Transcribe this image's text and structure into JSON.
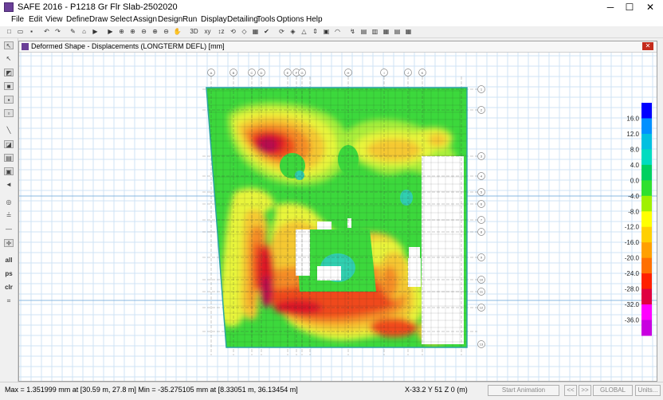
{
  "window": {
    "title": "SAFE 2016 - P1218 Gr Flr Slab-2502020",
    "minimize": "─",
    "maximize": "☐",
    "close": "✕"
  },
  "menu": [
    "File",
    "Edit",
    "View",
    "Define",
    "Draw",
    "Select",
    "Assign",
    "Design",
    "Run",
    "Display",
    "Detailing",
    "Tools",
    "Options",
    "Help"
  ],
  "toolbar": [
    {
      "icon": "new-file-icon",
      "glyph": "□"
    },
    {
      "icon": "open-icon",
      "glyph": "▭"
    },
    {
      "icon": "save-icon",
      "glyph": "▪"
    },
    {
      "icon": "undo-icon",
      "glyph": "↶"
    },
    {
      "icon": "redo-icon",
      "glyph": "↷"
    },
    {
      "icon": "pencil-icon",
      "glyph": "✎"
    },
    {
      "icon": "lock-icon",
      "glyph": "⌂"
    },
    {
      "icon": "run-icon",
      "glyph": "▶"
    },
    {
      "icon": "run-all-icon",
      "glyph": "▶"
    },
    {
      "icon": "zoom-window-icon",
      "glyph": "⊕"
    },
    {
      "icon": "zoom-in-icon",
      "glyph": "⊕"
    },
    {
      "icon": "zoom-out-icon",
      "glyph": "⊖"
    },
    {
      "icon": "zoom-fit-icon",
      "glyph": "⊕"
    },
    {
      "icon": "zoom-prev-icon",
      "glyph": "⊖"
    },
    {
      "icon": "pan-icon",
      "glyph": "✋"
    },
    {
      "icon": "view-3d-icon",
      "glyph": "3D"
    },
    {
      "icon": "view-xy-icon",
      "glyph": "xy"
    },
    {
      "icon": "view-elev-icon",
      "glyph": "↕z"
    },
    {
      "icon": "rotate-icon",
      "glyph": "⟲"
    },
    {
      "icon": "perspective-icon",
      "glyph": "◇"
    },
    {
      "icon": "object-shrink-icon",
      "glyph": "▦"
    },
    {
      "icon": "check-icon",
      "glyph": "✔"
    },
    {
      "icon": "refresh-icon",
      "glyph": "⟳"
    },
    {
      "icon": "select-icon",
      "glyph": "◈"
    },
    {
      "icon": "warning-icon",
      "glyph": "△"
    },
    {
      "icon": "ruler-icon",
      "glyph": "⇕"
    },
    {
      "icon": "display-icon",
      "glyph": "▣"
    },
    {
      "icon": "deformed-icon",
      "glyph": "◠"
    },
    {
      "icon": "forces-icon",
      "glyph": "↯"
    },
    {
      "icon": "stress-icon",
      "glyph": "▤"
    },
    {
      "icon": "contour-icon",
      "glyph": "▥"
    },
    {
      "icon": "table-icon",
      "glyph": "▦"
    },
    {
      "icon": "report-icon",
      "glyph": "▤"
    },
    {
      "icon": "grid-icon",
      "glyph": "▦"
    }
  ],
  "leftbar": [
    {
      "icon": "pointer-icon",
      "glyph": "↖",
      "type": "box"
    },
    {
      "icon": "reshape-icon",
      "glyph": "↖",
      "type": ""
    },
    {
      "icon": "draw-area-icon",
      "glyph": "◩",
      "type": "box"
    },
    {
      "icon": "draw-rect-icon",
      "glyph": "■",
      "type": "box"
    },
    {
      "icon": "draw-slab-icon",
      "glyph": "▪",
      "type": "box"
    },
    {
      "icon": "draw-column-icon",
      "glyph": "▫",
      "type": "box"
    },
    {
      "icon": "draw-line-icon",
      "glyph": "╲",
      "type": ""
    },
    {
      "icon": "draw-beam-icon",
      "glyph": "◪",
      "type": "box"
    },
    {
      "icon": "draw-wall-icon",
      "glyph": "▤",
      "type": "box"
    },
    {
      "icon": "draw-point-icon",
      "glyph": "▣",
      "type": "box"
    },
    {
      "icon": "draw-tendon-icon",
      "glyph": "◄",
      "type": ""
    },
    {
      "icon": "snap-icon",
      "glyph": "◎",
      "type": ""
    },
    {
      "icon": "draw-dimension-icon",
      "glyph": "≟",
      "type": ""
    },
    {
      "icon": "reference-line-icon",
      "glyph": "—",
      "type": ""
    },
    {
      "icon": "intersection-icon",
      "glyph": "✛",
      "type": "box"
    },
    {
      "icon": "select-all-label",
      "glyph": "all",
      "type": "txt"
    },
    {
      "icon": "select-ps-label",
      "glyph": "ps",
      "type": "txt"
    },
    {
      "icon": "clear-label",
      "glyph": "clr",
      "type": "txt"
    },
    {
      "icon": "snap-grid-icon",
      "glyph": "⌗",
      "type": ""
    }
  ],
  "view": {
    "title": "Deformed Shape - Displacements (LONGTERM DEFL)  [mm]",
    "close": "✕"
  },
  "grid_bubbles_top": [
    "A",
    "B",
    "C",
    "D",
    "E",
    "F",
    "G",
    "H",
    "I",
    "J",
    "K"
  ],
  "grid_bubbles_right": [
    "1",
    "2",
    "3",
    "4",
    "5",
    "6",
    "7",
    "8",
    "9",
    "10",
    "11",
    "12",
    "13"
  ],
  "legend": {
    "labels": [
      "16.0",
      "12.0",
      "8.0",
      "4.0",
      "0.0",
      "-4.0",
      "-8.0",
      "-12.0",
      "-16.0",
      "-20.0",
      "-24.0",
      "-28.0",
      "-32.0",
      "-36.0"
    ],
    "colors": [
      "#0000ff",
      "#0090ff",
      "#00c0e0",
      "#00dcc0",
      "#00d060",
      "#30e030",
      "#a0f000",
      "#ffff00",
      "#ffd000",
      "#ffa000",
      "#ff7000",
      "#ff2000",
      "#e00040",
      "#ff00ff",
      "#c800e0"
    ]
  },
  "contour_colors": {
    "background": "#3cd83c",
    "bands": [
      "#a8ee3a",
      "#e8f53a",
      "#f5c832",
      "#f58c28",
      "#ef4a1e",
      "#dc1428",
      "#b40a50"
    ],
    "cyan": "#30d0b0"
  },
  "status": {
    "max_min": "Max = 1.351999 mm at [30.59 m, 27.8 m]    Min = -35.275105 mm at [8.33051 m, 36.13454 m]",
    "coords": "X-33.2  Y 51  Z 0  (m)",
    "animation": "Start Animation",
    "prev": "<<",
    "next": ">>",
    "coord_system": "GLOBAL",
    "units": "Units..."
  }
}
